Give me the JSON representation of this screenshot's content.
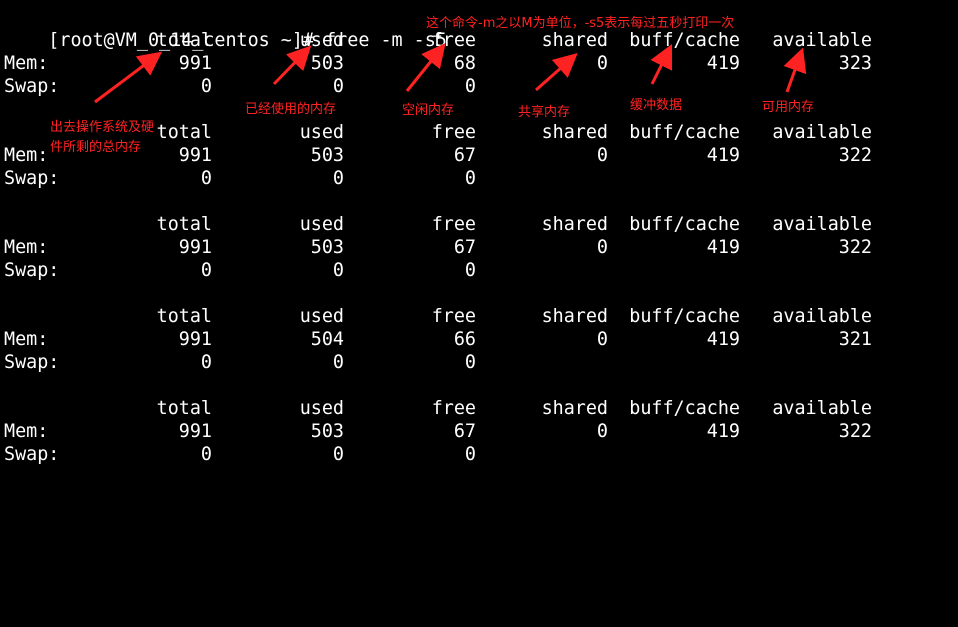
{
  "terminal": {
    "prompt": "[root@VM_0_14_centos ~]# free -m -s5",
    "header": {
      "total": "total",
      "used": "used",
      "free": "free",
      "shared": "shared",
      "buff_cache": "buff/cache",
      "available": "available"
    },
    "blocks": [
      {
        "mem": {
          "label": "Mem:",
          "total": "991",
          "used": "503",
          "free": "68",
          "shared": "0",
          "buff_cache": "419",
          "available": "323"
        },
        "swap": {
          "label": "Swap:",
          "total": "0",
          "used": "0",
          "free": "0"
        }
      },
      {
        "mem": {
          "label": "Mem:",
          "total": "991",
          "used": "503",
          "free": "67",
          "shared": "0",
          "buff_cache": "419",
          "available": "322"
        },
        "swap": {
          "label": "Swap:",
          "total": "0",
          "used": "0",
          "free": "0"
        }
      },
      {
        "mem": {
          "label": "Mem:",
          "total": "991",
          "used": "503",
          "free": "67",
          "shared": "0",
          "buff_cache": "419",
          "available": "322"
        },
        "swap": {
          "label": "Swap:",
          "total": "0",
          "used": "0",
          "free": "0"
        }
      },
      {
        "mem": {
          "label": "Mem:",
          "total": "991",
          "used": "504",
          "free": "66",
          "shared": "0",
          "buff_cache": "419",
          "available": "321"
        },
        "swap": {
          "label": "Swap:",
          "total": "0",
          "used": "0",
          "free": "0"
        }
      },
      {
        "mem": {
          "label": "Mem:",
          "total": "991",
          "used": "503",
          "free": "67",
          "shared": "0",
          "buff_cache": "419",
          "available": "322"
        },
        "swap": {
          "label": "Swap:",
          "total": "0",
          "used": "0",
          "free": "0"
        }
      }
    ]
  },
  "annotations": {
    "command_note": "这个命令-m之以M为单位，-s5表示每过五秒打印一次",
    "total_note": "出去操作系统及硬件所剩的总内存",
    "used_note": "已经使用的内存",
    "free_note": "空闲内存",
    "shared_note": "共享内存",
    "buff_note": "缓冲数据",
    "available_note": "可用内存",
    "color": "#ff2222"
  },
  "colors": {
    "background": "#000000",
    "text": "#ffffff",
    "annotation": "#ff2222"
  }
}
